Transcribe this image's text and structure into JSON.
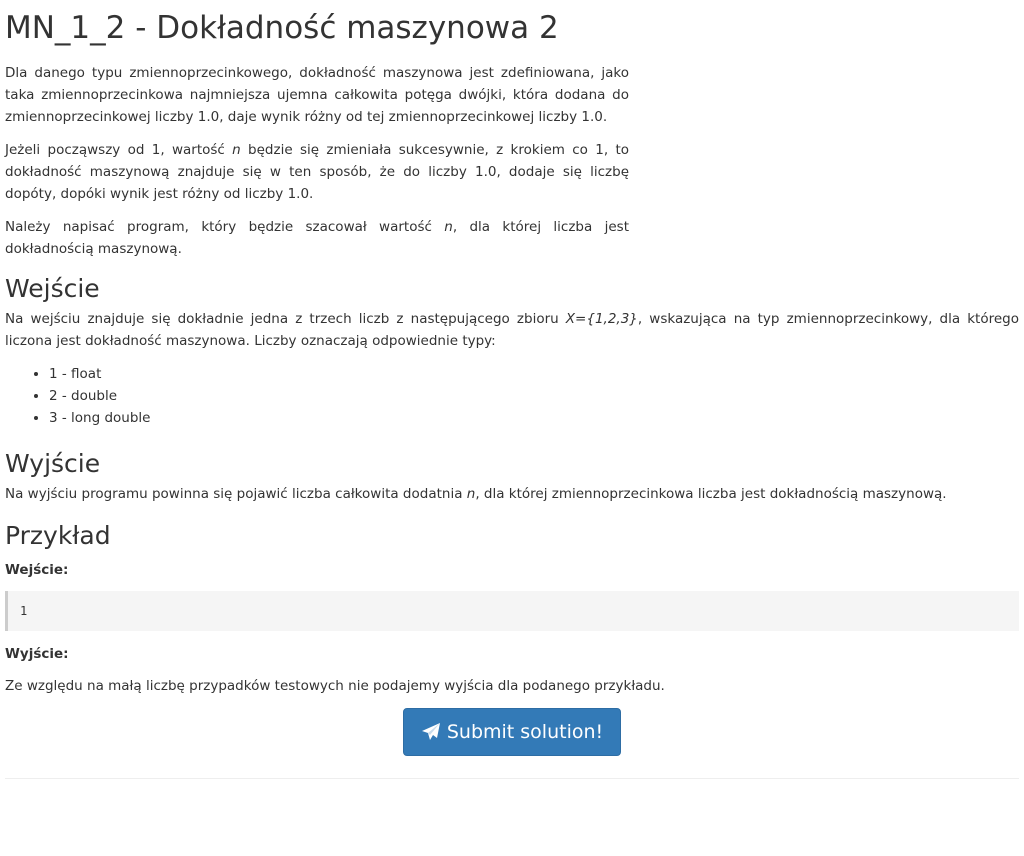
{
  "title": "MN_1_2 - Dokładność maszynowa 2",
  "intro": {
    "p1": "Dla danego typu zmiennoprzecinkowego, dokładność maszynowa jest zdefiniowana, jako taka zmiennoprzecinkowa najmniejsza ujemna całkowita potęga dwójki, która dodana do zmiennoprzecinkowej liczby 1.0, daje wynik różny od tej zmiennoprzecinkowej liczby 1.0.",
    "p2_a": "Jeżeli począwszy od 1, wartość ",
    "p2_var": "n",
    "p2_b": " będzie się zmieniała sukcesywnie, z krokiem co 1, to dokładność maszynową znajduje się w ten sposób, że do liczby 1.0, dodaje się liczbę dopóty, dopóki wynik jest różny od liczby 1.0.",
    "p3_a": "Należy napisać program, który będzie szacował wartość ",
    "p3_var": "n",
    "p3_b": ", dla której liczba jest dokładnością maszynową."
  },
  "input_section": {
    "heading": "Wejście",
    "text_a": "Na wejściu znajduje się dokładnie jedna z trzech liczb z następującego zbioru ",
    "text_set": "X={1,2,3}",
    "text_b": ", wskazująca na typ zmiennoprzecinkowy, dla którego liczona jest dokładność maszynowa. Liczby oznaczają odpowiednie typy:",
    "types": [
      "1 - float",
      "2 - double",
      "3 - long double"
    ]
  },
  "output_section": {
    "heading": "Wyjście",
    "text_a": "Na wyjściu programu powinna się pojawić liczba całkowita dodatnia ",
    "text_var": "n",
    "text_b": ", dla której zmiennoprzecinkowa liczba jest dokładnością maszynową."
  },
  "example": {
    "heading": "Przykład",
    "input_label": "Wejście:",
    "input_value": "1",
    "output_label": "Wyjście:",
    "output_note": "Ze względu na małą liczbę przypadków testowych nie podajemy wyjścia dla podanego przykładu."
  },
  "submit": {
    "label": "Submit solution!",
    "icon": "paper-plane-icon",
    "color": "#337ab7"
  }
}
